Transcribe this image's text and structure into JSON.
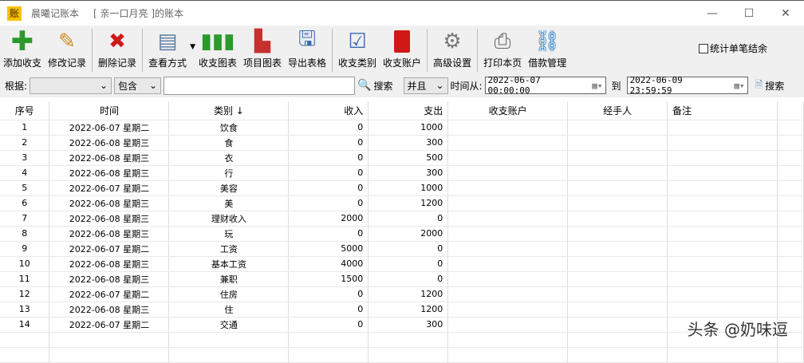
{
  "window": {
    "app_name": "晨曦记账本",
    "book": "[ 亲一口月亮 ]的账本",
    "logo": "账",
    "minimize": "—",
    "maximize": "☐",
    "close": "✕"
  },
  "toolbar": {
    "items": [
      {
        "label": "添加收支",
        "icon": "plus-icon"
      },
      {
        "label": "修改记录",
        "icon": "edit-icon"
      },
      {
        "label": "删除记录",
        "icon": "delete-icon"
      },
      {
        "label": "查看方式",
        "icon": "document-icon"
      },
      {
        "label": "收支图表",
        "icon": "bar-chart-icon"
      },
      {
        "label": "项目图表",
        "icon": "3d-chart-icon"
      },
      {
        "label": "导出表格",
        "icon": "export-icon"
      },
      {
        "label": "收支类别",
        "icon": "checklist-icon"
      },
      {
        "label": "收支账户",
        "icon": "book-icon"
      },
      {
        "label": "高级设置",
        "icon": "gear-icon"
      },
      {
        "label": "打印本页",
        "icon": "printer-icon"
      },
      {
        "label": "借款管理",
        "icon": "network-icon"
      }
    ],
    "checkbox_label": "统计单笔结余",
    "checkbox_checked": false
  },
  "search": {
    "by_label": "根据:",
    "field_value": "",
    "match_value": "包含",
    "keyword": "",
    "search_label": "搜索",
    "logic_value": "并且",
    "time_from_label": "时间从:",
    "from": "2022-06-07 00:00:00",
    "to_label": "到",
    "to": "2022-06-09 23:59:59",
    "search2_label": "搜索"
  },
  "table": {
    "headers": [
      "序号",
      "时间",
      "类别 ↓",
      "收入",
      "支出",
      "收支账户",
      "经手人",
      "备注"
    ],
    "rows": [
      [
        "1",
        "2022-06-07 星期二",
        "饮食",
        "0",
        "1000"
      ],
      [
        "2",
        "2022-06-08 星期三",
        "食",
        "0",
        "300"
      ],
      [
        "3",
        "2022-06-08 星期三",
        "衣",
        "0",
        "500"
      ],
      [
        "4",
        "2022-06-08 星期三",
        "行",
        "0",
        "300"
      ],
      [
        "5",
        "2022-06-07 星期二",
        "美容",
        "0",
        "1000"
      ],
      [
        "6",
        "2022-06-08 星期三",
        "美",
        "0",
        "1200"
      ],
      [
        "7",
        "2022-06-08 星期三",
        "理财收入",
        "2000",
        "0"
      ],
      [
        "8",
        "2022-06-08 星期三",
        "玩",
        "0",
        "2000"
      ],
      [
        "9",
        "2022-06-07 星期二",
        "工资",
        "5000",
        "0"
      ],
      [
        "10",
        "2022-06-08 星期三",
        "基本工资",
        "4000",
        "0"
      ],
      [
        "11",
        "2022-06-08 星期三",
        "兼职",
        "1500",
        "0"
      ],
      [
        "12",
        "2022-06-07 星期二",
        "住房",
        "0",
        "1200"
      ],
      [
        "13",
        "2022-06-08 星期三",
        "住",
        "0",
        "1200"
      ],
      [
        "14",
        "2022-06-07 星期二",
        "交通",
        "0",
        "300"
      ]
    ]
  },
  "watermark": "头条 @奶味逗"
}
